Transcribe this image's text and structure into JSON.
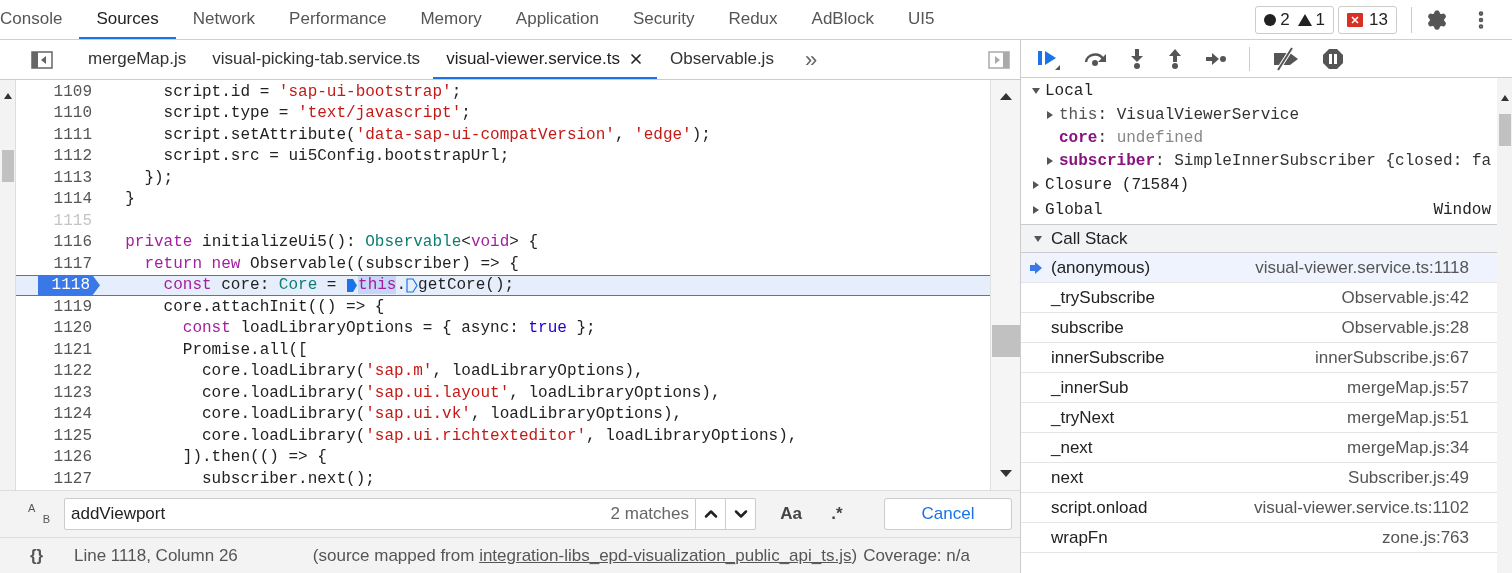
{
  "main_tabs": [
    {
      "label": "Console",
      "selected": false
    },
    {
      "label": "Sources",
      "selected": true
    },
    {
      "label": "Network",
      "selected": false
    },
    {
      "label": "Performance",
      "selected": false
    },
    {
      "label": "Memory",
      "selected": false
    },
    {
      "label": "Application",
      "selected": false
    },
    {
      "label": "Security",
      "selected": false
    },
    {
      "label": "Redux",
      "selected": false
    },
    {
      "label": "AdBlock",
      "selected": false
    },
    {
      "label": "UI5",
      "selected": false
    }
  ],
  "counters": {
    "errors": "2",
    "warnings": "1",
    "issues": "13"
  },
  "editor_tabs": [
    {
      "label": "mergeMap.js",
      "selected": false,
      "closable": false
    },
    {
      "label": "visual-picking-tab.service.ts",
      "selected": false,
      "closable": false
    },
    {
      "label": "visual-viewer.service.ts",
      "selected": true,
      "closable": true
    },
    {
      "label": "Observable.js",
      "selected": false,
      "closable": false
    }
  ],
  "editor_overflow": "»",
  "code_lines": [
    {
      "number": "1109",
      "dim": false,
      "current": false,
      "tokens": [
        {
          "kind": "plain",
          "text": "      script.id = "
        },
        {
          "kind": "str",
          "text": "'sap-ui-bootstrap'"
        },
        {
          "kind": "plain",
          "text": ";"
        }
      ]
    },
    {
      "number": "1110",
      "dim": false,
      "current": false,
      "tokens": [
        {
          "kind": "plain",
          "text": "      script.type = "
        },
        {
          "kind": "str",
          "text": "'text/javascript'"
        },
        {
          "kind": "plain",
          "text": ";"
        }
      ]
    },
    {
      "number": "1111",
      "dim": false,
      "current": false,
      "tokens": [
        {
          "kind": "plain",
          "text": "      script.setAttribute("
        },
        {
          "kind": "str",
          "text": "'data-sap-ui-compatVersion'"
        },
        {
          "kind": "plain",
          "text": ", "
        },
        {
          "kind": "str",
          "text": "'edge'"
        },
        {
          "kind": "plain",
          "text": ");"
        }
      ]
    },
    {
      "number": "1112",
      "dim": false,
      "current": false,
      "tokens": [
        {
          "kind": "plain",
          "text": "      script.src = ui5Config.bootstrapUrl;"
        }
      ]
    },
    {
      "number": "1113",
      "dim": false,
      "current": false,
      "tokens": [
        {
          "kind": "plain",
          "text": "    });"
        }
      ]
    },
    {
      "number": "1114",
      "dim": false,
      "current": false,
      "tokens": [
        {
          "kind": "plain",
          "text": "  }"
        }
      ]
    },
    {
      "number": "1115",
      "dim": true,
      "current": false
    },
    {
      "number": "1116",
      "dim": false,
      "current": false,
      "tokens": [
        {
          "kind": "kw",
          "text": "  private"
        },
        {
          "kind": "plain",
          "text": " initializeUi5(): "
        },
        {
          "kind": "type",
          "text": "Observable"
        },
        {
          "kind": "plain",
          "text": "<"
        },
        {
          "kind": "kw",
          "text": "void"
        },
        {
          "kind": "plain",
          "text": "> {"
        }
      ]
    },
    {
      "number": "1117",
      "dim": false,
      "current": false,
      "tokens": [
        {
          "kind": "kw",
          "text": "    return new"
        },
        {
          "kind": "plain",
          "text": " Observable((subscriber) => {"
        }
      ]
    },
    {
      "number": "1118",
      "dim": false,
      "current": true,
      "tokens": [
        {
          "kind": "kw",
          "text": "      const"
        },
        {
          "kind": "plain",
          "text": " core: "
        },
        {
          "kind": "type",
          "text": "Core"
        },
        {
          "kind": "plain",
          "text": " = "
        },
        {
          "kind": "marker",
          "active": true
        },
        {
          "kind": "kw",
          "text": "this",
          "highlight": true
        },
        {
          "kind": "plain",
          "text": "."
        },
        {
          "kind": "marker",
          "active": false
        },
        {
          "kind": "plain",
          "text": "getCore();"
        }
      ]
    },
    {
      "number": "1119",
      "dim": false,
      "current": false,
      "tokens": [
        {
          "kind": "plain",
          "text": "      core.attachInit(() => {"
        }
      ]
    },
    {
      "number": "1120",
      "dim": false,
      "current": false,
      "tokens": [
        {
          "kind": "kw",
          "text": "        const"
        },
        {
          "kind": "plain",
          "text": " loadLibraryOptions = { async: "
        },
        {
          "kind": "bool",
          "text": "true"
        },
        {
          "kind": "plain",
          "text": " };"
        }
      ]
    },
    {
      "number": "1121",
      "dim": false,
      "current": false,
      "tokens": [
        {
          "kind": "plain",
          "text": "        Promise.all(["
        }
      ]
    },
    {
      "number": "1122",
      "dim": false,
      "current": false,
      "tokens": [
        {
          "kind": "plain",
          "text": "          core.loadLibrary("
        },
        {
          "kind": "str",
          "text": "'sap.m'"
        },
        {
          "kind": "plain",
          "text": ", loadLibraryOptions),"
        }
      ]
    },
    {
      "number": "1123",
      "dim": false,
      "current": false,
      "tokens": [
        {
          "kind": "plain",
          "text": "          core.loadLibrary("
        },
        {
          "kind": "str",
          "text": "'sap.ui.layout'"
        },
        {
          "kind": "plain",
          "text": ", loadLibraryOptions),"
        }
      ]
    },
    {
      "number": "1124",
      "dim": false,
      "current": false,
      "tokens": [
        {
          "kind": "plain",
          "text": "          core.loadLibrary("
        },
        {
          "kind": "str",
          "text": "'sap.ui.vk'"
        },
        {
          "kind": "plain",
          "text": ", loadLibraryOptions),"
        }
      ]
    },
    {
      "number": "1125",
      "dim": false,
      "current": false,
      "tokens": [
        {
          "kind": "plain",
          "text": "          core.loadLibrary("
        },
        {
          "kind": "str",
          "text": "'sap.ui.richtexteditor'"
        },
        {
          "kind": "plain",
          "text": ", loadLibraryOptions),"
        }
      ]
    },
    {
      "number": "1126",
      "dim": false,
      "current": false,
      "tokens": [
        {
          "kind": "plain",
          "text": "        ]).then(() => {"
        }
      ]
    },
    {
      "number": "1127",
      "dim": false,
      "current": false,
      "tokens": [
        {
          "kind": "plain",
          "text": "          subscriber.next();"
        }
      ]
    }
  ],
  "search": {
    "replace_icon": [
      "A",
      "B"
    ],
    "value": "addViewport",
    "matches": "2 matches",
    "case_toggle": "Aa",
    "regex_toggle": ".*",
    "cancel": "Cancel"
  },
  "status_bar": {
    "format_icon": "{}",
    "position": "Line 1118, Column 26",
    "source_prefix": "(source mapped from ",
    "source_link": "integration-libs_epd-visualization_public_api_ts.js",
    "source_suffix": ")",
    "coverage": "Coverage: n/a"
  },
  "scope": [
    {
      "label": "Local",
      "expanded": true,
      "children": [
        {
          "name": "this",
          "separator": ":",
          "value": "VisualViewerService",
          "kind": "object",
          "special": true
        },
        {
          "name": "core",
          "separator": ":",
          "value": "undefined",
          "kind": "value",
          "special": false
        },
        {
          "name": "subscriber",
          "separator": ":",
          "value": "SimpleInnerSubscriber {closed: fa",
          "kind": "object",
          "special": false
        }
      ]
    },
    {
      "label": "Closure (71584)",
      "expanded": false
    },
    {
      "label": "Global",
      "expanded": false,
      "value": "Window"
    }
  ],
  "call_stack": {
    "title": "Call Stack",
    "expanded": true,
    "frames": [
      {
        "name": "(anonymous)",
        "location": "visual-viewer.service.ts:1118",
        "selected": true
      },
      {
        "name": "_trySubscribe",
        "location": "Observable.js:42",
        "selected": false
      },
      {
        "name": "subscribe",
        "location": "Observable.js:28",
        "selected": false
      },
      {
        "name": "innerSubscribe",
        "location": "innerSubscribe.js:67",
        "selected": false
      },
      {
        "name": "_innerSub",
        "location": "mergeMap.js:57",
        "selected": false
      },
      {
        "name": "_tryNext",
        "location": "mergeMap.js:51",
        "selected": false
      },
      {
        "name": "_next",
        "location": "mergeMap.js:34",
        "selected": false
      },
      {
        "name": "next",
        "location": "Subscriber.js:49",
        "selected": false
      },
      {
        "name": "script.onload",
        "location": "visual-viewer.service.ts:1102",
        "selected": false
      },
      {
        "name": "wrapFn",
        "location": "zone.js:763",
        "selected": false
      }
    ]
  }
}
